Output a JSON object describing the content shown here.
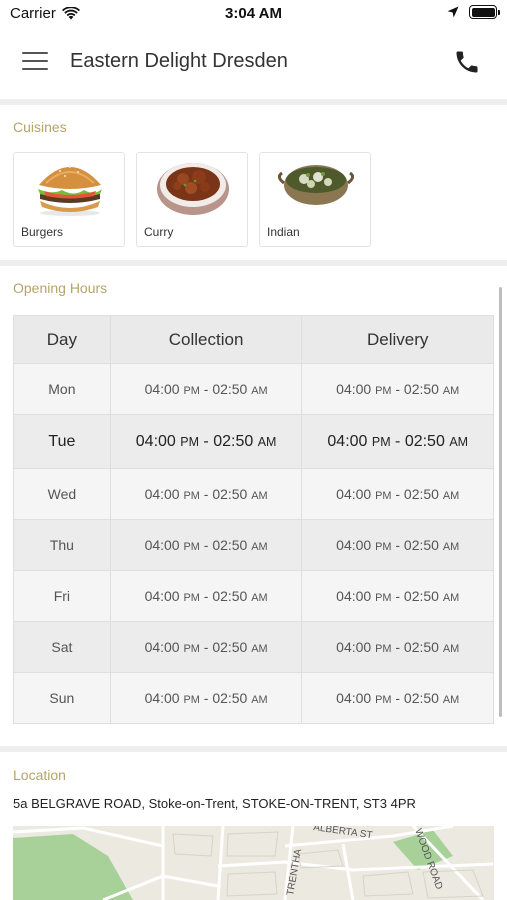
{
  "status_bar": {
    "carrier": "Carrier",
    "time": "3:04 AM"
  },
  "header": {
    "title": "Eastern Delight Dresden"
  },
  "cuisines": {
    "label": "Cuisines",
    "items": [
      {
        "label": "Burgers",
        "icon": "burger-image"
      },
      {
        "label": "Curry",
        "icon": "curry-image"
      },
      {
        "label": "Indian",
        "icon": "indian-dish-image"
      }
    ]
  },
  "opening_hours": {
    "label": "Opening Hours",
    "headers": [
      "Day",
      "Collection",
      "Delivery"
    ],
    "rows": [
      {
        "day": "Mon",
        "collection": {
          "open": "04:00",
          "open_period": "PM",
          "close": "02:50",
          "close_period": "AM"
        },
        "delivery": {
          "open": "04:00",
          "open_period": "PM",
          "close": "02:50",
          "close_period": "AM"
        }
      },
      {
        "day": "Tue",
        "collection": {
          "open": "04:00",
          "open_period": "PM",
          "close": "02:50",
          "close_period": "AM"
        },
        "delivery": {
          "open": "04:00",
          "open_period": "PM",
          "close": "02:50",
          "close_period": "AM"
        }
      },
      {
        "day": "Wed",
        "collection": {
          "open": "04:00",
          "open_period": "PM",
          "close": "02:50",
          "close_period": "AM"
        },
        "delivery": {
          "open": "04:00",
          "open_period": "PM",
          "close": "02:50",
          "close_period": "AM"
        }
      },
      {
        "day": "Thu",
        "collection": {
          "open": "04:00",
          "open_period": "PM",
          "close": "02:50",
          "close_period": "AM"
        },
        "delivery": {
          "open": "04:00",
          "open_period": "PM",
          "close": "02:50",
          "close_period": "AM"
        }
      },
      {
        "day": "Fri",
        "collection": {
          "open": "04:00",
          "open_period": "PM",
          "close": "02:50",
          "close_period": "AM"
        },
        "delivery": {
          "open": "04:00",
          "open_period": "PM",
          "close": "02:50",
          "close_period": "AM"
        }
      },
      {
        "day": "Sat",
        "collection": {
          "open": "04:00",
          "open_period": "PM",
          "close": "02:50",
          "close_period": "AM"
        },
        "delivery": {
          "open": "04:00",
          "open_period": "PM",
          "close": "02:50",
          "close_period": "AM"
        }
      },
      {
        "day": "Sun",
        "collection": {
          "open": "04:00",
          "open_period": "PM",
          "close": "02:50",
          "close_period": "AM"
        },
        "delivery": {
          "open": "04:00",
          "open_period": "PM",
          "close": "02:50",
          "close_period": "AM"
        }
      }
    ]
  },
  "location": {
    "label": "Location",
    "address": "5a BELGRAVE ROAD, Stoke-on-Trent, STOKE-ON-TRENT, ST3 4PR",
    "map_street_labels": [
      "TRENTHA",
      "ALBERTA ST",
      "WOOD ROAD"
    ]
  },
  "colors": {
    "section_label": "#b5a36c",
    "divider": "#eeeeee",
    "map_park": "#a8d19a"
  }
}
